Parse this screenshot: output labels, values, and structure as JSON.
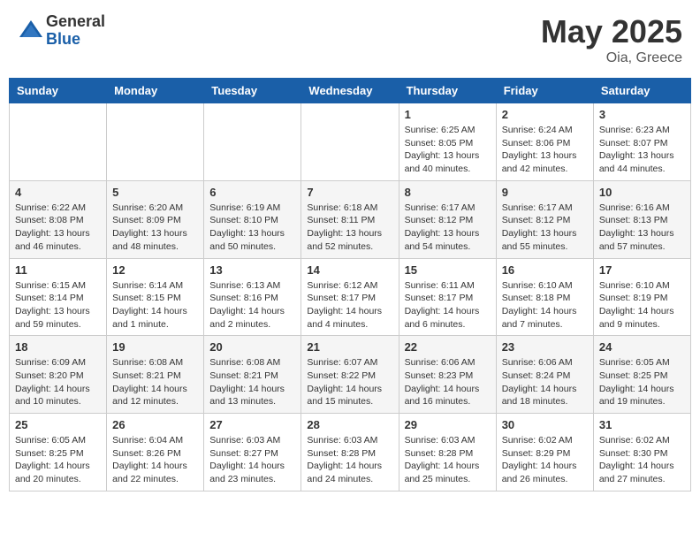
{
  "header": {
    "logo_general": "General",
    "logo_blue": "Blue",
    "month_year": "May 2025",
    "location": "Oia, Greece"
  },
  "days_of_week": [
    "Sunday",
    "Monday",
    "Tuesday",
    "Wednesday",
    "Thursday",
    "Friday",
    "Saturday"
  ],
  "weeks": [
    [
      {
        "day": "",
        "info": ""
      },
      {
        "day": "",
        "info": ""
      },
      {
        "day": "",
        "info": ""
      },
      {
        "day": "",
        "info": ""
      },
      {
        "day": "1",
        "info": "Sunrise: 6:25 AM\nSunset: 8:05 PM\nDaylight: 13 hours and 40 minutes."
      },
      {
        "day": "2",
        "info": "Sunrise: 6:24 AM\nSunset: 8:06 PM\nDaylight: 13 hours and 42 minutes."
      },
      {
        "day": "3",
        "info": "Sunrise: 6:23 AM\nSunset: 8:07 PM\nDaylight: 13 hours and 44 minutes."
      }
    ],
    [
      {
        "day": "4",
        "info": "Sunrise: 6:22 AM\nSunset: 8:08 PM\nDaylight: 13 hours and 46 minutes."
      },
      {
        "day": "5",
        "info": "Sunrise: 6:20 AM\nSunset: 8:09 PM\nDaylight: 13 hours and 48 minutes."
      },
      {
        "day": "6",
        "info": "Sunrise: 6:19 AM\nSunset: 8:10 PM\nDaylight: 13 hours and 50 minutes."
      },
      {
        "day": "7",
        "info": "Sunrise: 6:18 AM\nSunset: 8:11 PM\nDaylight: 13 hours and 52 minutes."
      },
      {
        "day": "8",
        "info": "Sunrise: 6:17 AM\nSunset: 8:12 PM\nDaylight: 13 hours and 54 minutes."
      },
      {
        "day": "9",
        "info": "Sunrise: 6:17 AM\nSunset: 8:12 PM\nDaylight: 13 hours and 55 minutes."
      },
      {
        "day": "10",
        "info": "Sunrise: 6:16 AM\nSunset: 8:13 PM\nDaylight: 13 hours and 57 minutes."
      }
    ],
    [
      {
        "day": "11",
        "info": "Sunrise: 6:15 AM\nSunset: 8:14 PM\nDaylight: 13 hours and 59 minutes."
      },
      {
        "day": "12",
        "info": "Sunrise: 6:14 AM\nSunset: 8:15 PM\nDaylight: 14 hours and 1 minute."
      },
      {
        "day": "13",
        "info": "Sunrise: 6:13 AM\nSunset: 8:16 PM\nDaylight: 14 hours and 2 minutes."
      },
      {
        "day": "14",
        "info": "Sunrise: 6:12 AM\nSunset: 8:17 PM\nDaylight: 14 hours and 4 minutes."
      },
      {
        "day": "15",
        "info": "Sunrise: 6:11 AM\nSunset: 8:17 PM\nDaylight: 14 hours and 6 minutes."
      },
      {
        "day": "16",
        "info": "Sunrise: 6:10 AM\nSunset: 8:18 PM\nDaylight: 14 hours and 7 minutes."
      },
      {
        "day": "17",
        "info": "Sunrise: 6:10 AM\nSunset: 8:19 PM\nDaylight: 14 hours and 9 minutes."
      }
    ],
    [
      {
        "day": "18",
        "info": "Sunrise: 6:09 AM\nSunset: 8:20 PM\nDaylight: 14 hours and 10 minutes."
      },
      {
        "day": "19",
        "info": "Sunrise: 6:08 AM\nSunset: 8:21 PM\nDaylight: 14 hours and 12 minutes."
      },
      {
        "day": "20",
        "info": "Sunrise: 6:08 AM\nSunset: 8:21 PM\nDaylight: 14 hours and 13 minutes."
      },
      {
        "day": "21",
        "info": "Sunrise: 6:07 AM\nSunset: 8:22 PM\nDaylight: 14 hours and 15 minutes."
      },
      {
        "day": "22",
        "info": "Sunrise: 6:06 AM\nSunset: 8:23 PM\nDaylight: 14 hours and 16 minutes."
      },
      {
        "day": "23",
        "info": "Sunrise: 6:06 AM\nSunset: 8:24 PM\nDaylight: 14 hours and 18 minutes."
      },
      {
        "day": "24",
        "info": "Sunrise: 6:05 AM\nSunset: 8:25 PM\nDaylight: 14 hours and 19 minutes."
      }
    ],
    [
      {
        "day": "25",
        "info": "Sunrise: 6:05 AM\nSunset: 8:25 PM\nDaylight: 14 hours and 20 minutes."
      },
      {
        "day": "26",
        "info": "Sunrise: 6:04 AM\nSunset: 8:26 PM\nDaylight: 14 hours and 22 minutes."
      },
      {
        "day": "27",
        "info": "Sunrise: 6:03 AM\nSunset: 8:27 PM\nDaylight: 14 hours and 23 minutes."
      },
      {
        "day": "28",
        "info": "Sunrise: 6:03 AM\nSunset: 8:28 PM\nDaylight: 14 hours and 24 minutes."
      },
      {
        "day": "29",
        "info": "Sunrise: 6:03 AM\nSunset: 8:28 PM\nDaylight: 14 hours and 25 minutes."
      },
      {
        "day": "30",
        "info": "Sunrise: 6:02 AM\nSunset: 8:29 PM\nDaylight: 14 hours and 26 minutes."
      },
      {
        "day": "31",
        "info": "Sunrise: 6:02 AM\nSunset: 8:30 PM\nDaylight: 14 hours and 27 minutes."
      }
    ]
  ]
}
